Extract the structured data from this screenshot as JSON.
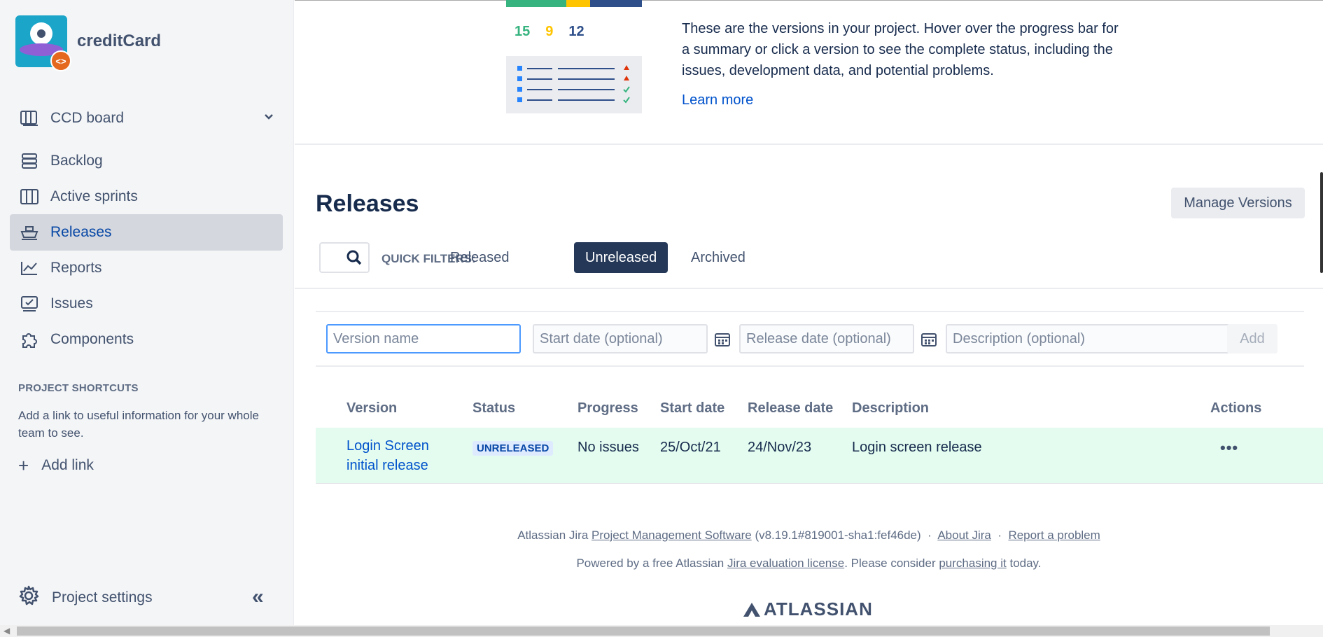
{
  "project": {
    "name": "creditCard",
    "badge": "<>"
  },
  "sidebar": {
    "items": [
      {
        "label": "CCD board",
        "icon": "board-icon"
      },
      {
        "label": "Backlog",
        "icon": "backlog-icon"
      },
      {
        "label": "Active sprints",
        "icon": "sprint-icon"
      },
      {
        "label": "Releases",
        "icon": "ship-icon",
        "active": true
      },
      {
        "label": "Reports",
        "icon": "chart-icon"
      },
      {
        "label": "Issues",
        "icon": "issues-icon"
      },
      {
        "label": "Components",
        "icon": "puzzle-icon"
      }
    ],
    "shortcuts_title": "PROJECT SHORTCUTS",
    "shortcuts_desc": "Add a link to useful information for your whole team to see.",
    "add_link": "Add link",
    "settings": "Project settings"
  },
  "intro": {
    "text": "These are the versions in your project. Hover over the progress bar for a summary or click a version to see the complete status, including the issues, development data, and potential problems.",
    "learn_more": "Learn more",
    "numbers": [
      "15",
      "9",
      "12"
    ]
  },
  "releases": {
    "title": "Releases",
    "manage_button": "Manage Versions",
    "quick_filters_label": "QUICK FILTERS:",
    "filters": [
      "Released",
      "Unreleased",
      "Archived"
    ],
    "active_filter": "Unreleased"
  },
  "form": {
    "version_placeholder": "Version name",
    "start_placeholder": "Start date (optional)",
    "release_placeholder": "Release date (optional)",
    "description_placeholder": "Description (optional)",
    "add_label": "Add"
  },
  "table": {
    "headers": [
      "Version",
      "Status",
      "Progress",
      "Start date",
      "Release date",
      "Description",
      "Actions"
    ],
    "rows": [
      {
        "version": "Login Screen initial release",
        "status": "UNRELEASED",
        "progress": "No issues",
        "start": "25/Oct/21",
        "release": "24/Nov/23",
        "description": "Login screen release",
        "actions": "•••"
      }
    ]
  },
  "footer": {
    "line1_pre": "Atlassian Jira",
    "line1_link": "Project Management Software",
    "line1_version": "(v8.19.1#819001-sha1:fef46de)",
    "sep": "·",
    "about": "About Jira",
    "report": "Report a problem",
    "line2_pre": "Powered by a free Atlassian",
    "line2_link": "Jira evaluation license",
    "line2_mid": ". Please consider",
    "line2_link2": "purchasing it",
    "line2_post": "today.",
    "brand": "ATLASSIAN"
  }
}
